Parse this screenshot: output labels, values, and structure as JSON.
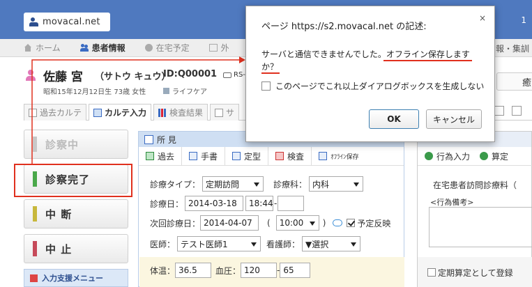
{
  "header": {
    "logo_text": "movacal.net",
    "right_text": "1"
  },
  "nav": {
    "items": [
      {
        "label": "ホーム",
        "icon": "home-icon",
        "active": false
      },
      {
        "label": "患者情報",
        "icon": "patients-icon",
        "active": true
      },
      {
        "label": "在宅予定",
        "icon": "clock-icon",
        "active": false
      },
      {
        "label": "外",
        "icon": "external-icon",
        "active": false
      }
    ],
    "right_text": "報・集訓"
  },
  "patient": {
    "name": "佐藤 宮",
    "kana": "（サトウ キュウ）",
    "id": "ID:Q00001",
    "rs_label": "RS-",
    "sub_info": "昭和15年12月12日生 73歳  女性",
    "care_label": "ライフケア",
    "button_label": "癒"
  },
  "tabs": [
    {
      "label": "過去カルテ",
      "active": false
    },
    {
      "label": "カルテ入力",
      "active": true
    },
    {
      "label": "検査結果",
      "active": false
    },
    {
      "label": "サ",
      "active": false
    }
  ],
  "status_buttons": [
    {
      "label": "診察中",
      "color": "#bbbbbb",
      "disabled": true
    },
    {
      "label": "診察完了",
      "color": "#4aa84a",
      "disabled": false
    },
    {
      "label": "中 断",
      "color": "#c8b83c",
      "disabled": false
    },
    {
      "label": "中 止",
      "color": "#c64a5a",
      "disabled": false
    }
  ],
  "support_menu": "入力支援メニュー",
  "findings": {
    "title": "所 見",
    "toolbar": {
      "past": "過去",
      "handwrite": "手書",
      "template": "定型",
      "exam": "検査",
      "offline": "ｵﾌﾗｲﾝ保存"
    },
    "visit_type_label": "診療タイプ：",
    "visit_type_value": "定期訪問",
    "dept_label": "診療科：",
    "dept_value": "内科",
    "date_label": "診療日：",
    "date_value": "2014-03-18",
    "time_value": "18:44",
    "dash": "-",
    "next_label": "次回診療日：",
    "next_value": "2014-04-07",
    "paren_open": "(",
    "next_time": "10:00",
    "paren_close": ")",
    "reflect_label": "予定反映",
    "doctor_label": "医師：",
    "doctor_value": "テスト医師1",
    "nurse_label": "看護師：",
    "nurse_value": "▼選択",
    "temp_label": "体温：",
    "temp_value": "36.5",
    "bp_label": "血圧：",
    "bp_sys": "120",
    "bp_dash": "-",
    "bp_dia": "65"
  },
  "right_panel": {
    "action_input": "行為入力",
    "calc": "算定",
    "text": "在宅患者訪問診療料（",
    "remark": "<行為備考>",
    "footer": "定期算定として登録"
  },
  "dialog": {
    "title": "ページ https://s2.movacal.net の記述:",
    "close": "×",
    "msg_line1": "サーバと通信できませんでした。オフライン保存します",
    "msg_line2": "か？",
    "checkbox_label": "このページでこれ以上ダイアログボックスを生成しない",
    "ok": "OK",
    "cancel": "キャンセル"
  },
  "colors": {
    "header_bg": "#4f79bf",
    "annotation_red": "#e0301e"
  }
}
